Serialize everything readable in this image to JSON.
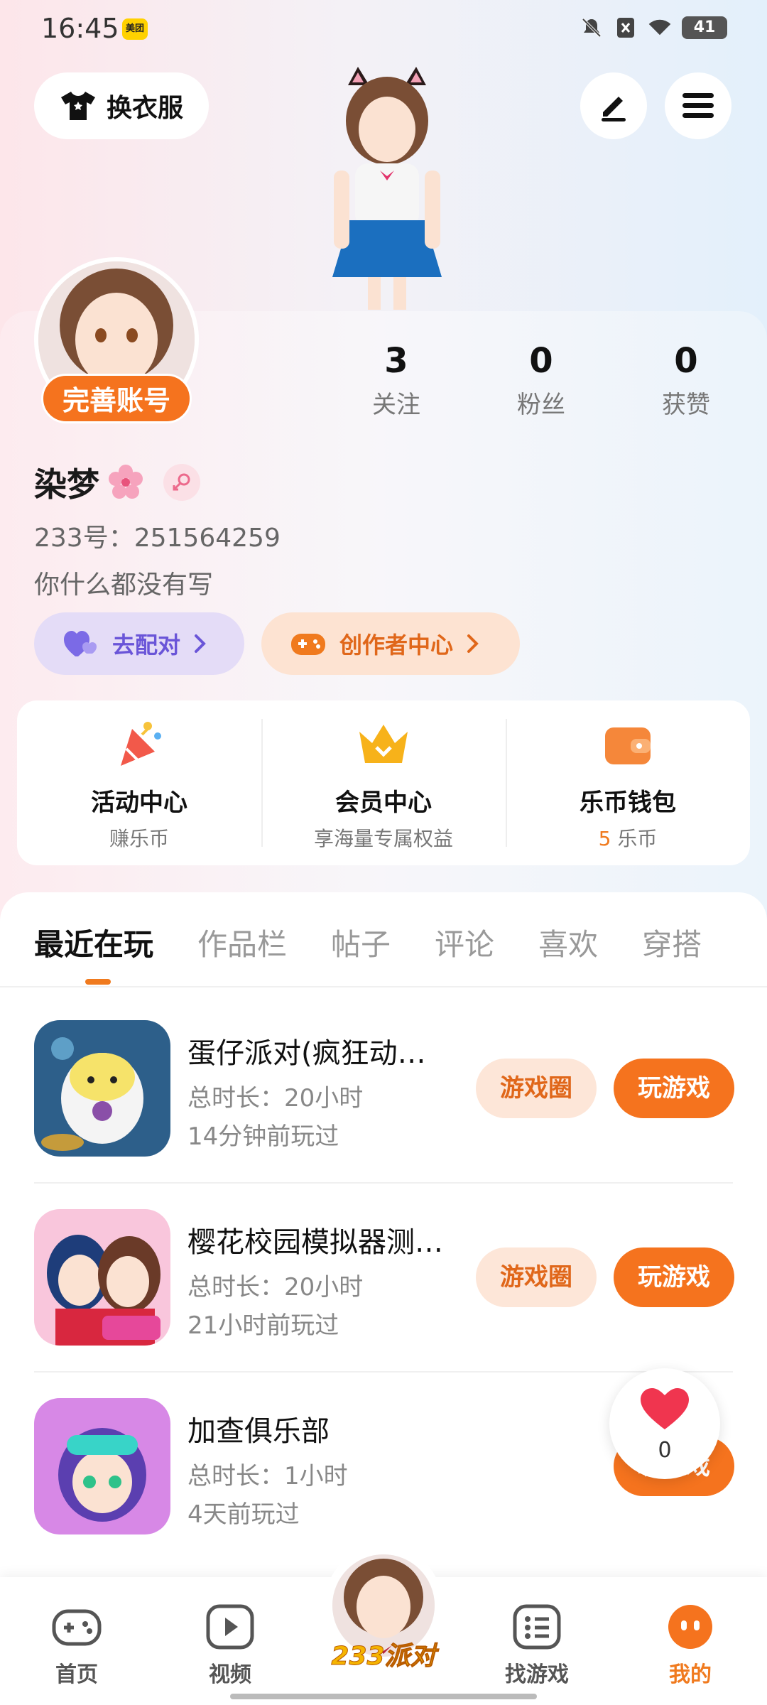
{
  "status_bar": {
    "time": "16:45",
    "app_badge": "美团",
    "battery": "41"
  },
  "top": {
    "dress_label": "换衣服"
  },
  "profile": {
    "complete_label": "完善账号",
    "stats": [
      {
        "value": "3",
        "label": "关注"
      },
      {
        "value": "0",
        "label": "粉丝"
      },
      {
        "value": "0",
        "label": "获赞"
      }
    ],
    "username": "染梦",
    "uid": "233号：251564259",
    "bio": "你什么都没有写",
    "match_label": "去配对",
    "creator_label": "创作者中心"
  },
  "services": [
    {
      "title": "活动中心",
      "sub": "赚乐币"
    },
    {
      "title": "会员中心",
      "sub": "享海量专属权益"
    },
    {
      "title": "乐币钱包",
      "coin": "5",
      "sub": "乐币"
    }
  ],
  "tabs": [
    "最近在玩",
    "作品栏",
    "帖子",
    "评论",
    "喜欢",
    "穿搭"
  ],
  "games": [
    {
      "title": "蛋仔派对(疯狂动…",
      "duration": "总时长：20小时",
      "last": "14分钟前玩过",
      "circle": "游戏圈",
      "play": "玩游戏"
    },
    {
      "title": "樱花校园模拟器测…",
      "duration": "总时长：20小时",
      "last": "21小时前玩过",
      "circle": "游戏圈",
      "play": "玩游戏"
    },
    {
      "title": "加查俱乐部",
      "duration": "总时长：1小时",
      "last": "4天前玩过",
      "play": "玩游戏"
    }
  ],
  "float_like": {
    "count": "0"
  },
  "bottom_nav": {
    "home": "首页",
    "video": "视频",
    "center": "233派对",
    "find": "找游戏",
    "mine": "我的"
  },
  "colors": {
    "accent": "#f5731e",
    "purple": "#6a55d8"
  }
}
